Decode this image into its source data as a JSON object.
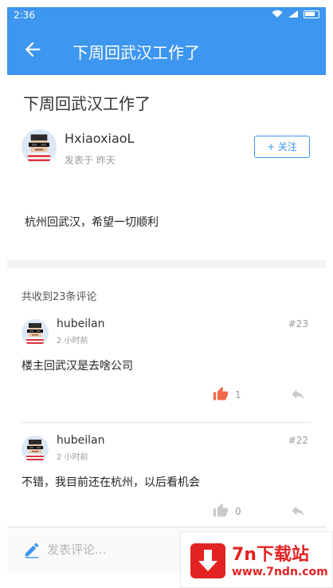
{
  "status_bar": {
    "time": "2:36"
  },
  "app_bar": {
    "title": "下周回武汉工作了"
  },
  "post": {
    "title": "下周回武汉工作了",
    "author": "HxiaoxiaoL",
    "meta": "发表于 昨天",
    "follow_label": "+ 关注",
    "body": "杭州回武汉，希望一切顺利"
  },
  "comments_header": "共收到23条评论",
  "comments": [
    {
      "name": "hubeilan",
      "time": "2 小时前",
      "floor": "#23",
      "text": "楼主回武汉是去啥公司",
      "likes": "1",
      "liked": true
    },
    {
      "name": "hubeilan",
      "time": "2 小时前",
      "floor": "#22",
      "text": "不错，我目前还在杭州，以后看机会",
      "likes": "0",
      "liked": false
    }
  ],
  "bottom_bar": {
    "placeholder": "发表评论..."
  },
  "watermark": {
    "name": "7n下载站",
    "url": "www.7ndn.com"
  },
  "colors": {
    "primary": "#3d96f0",
    "like_active": "#f06a4b",
    "like_inactive": "#c9c9c9",
    "watermark": "#e32322"
  }
}
